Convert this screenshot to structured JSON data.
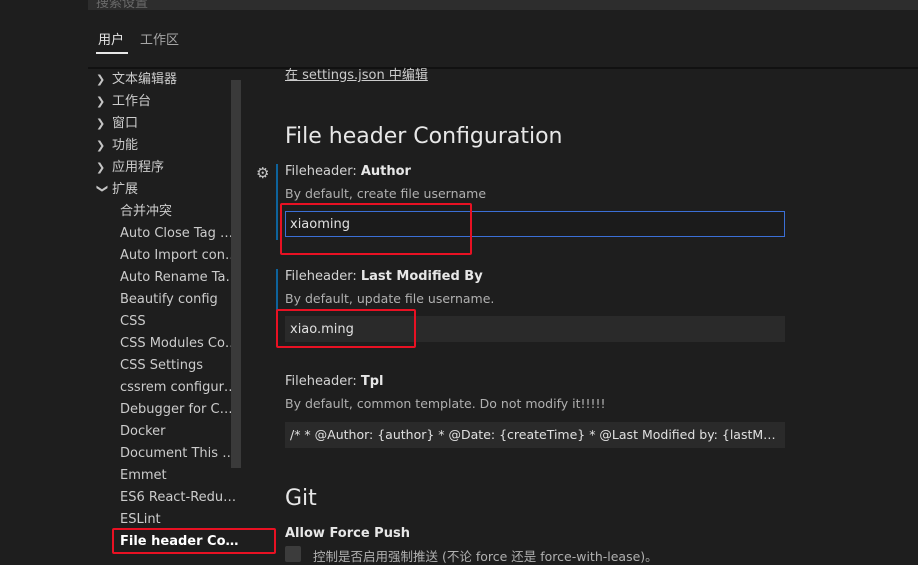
{
  "search": {
    "placeholder": "搜索设置"
  },
  "tabs": [
    {
      "label": "用户"
    },
    {
      "label": "工作区"
    }
  ],
  "toc": {
    "top_items": [
      {
        "label": "文本编辑器",
        "state": "collapsed"
      },
      {
        "label": "工作台",
        "state": "collapsed"
      },
      {
        "label": "窗口",
        "state": "collapsed"
      },
      {
        "label": "功能",
        "state": "collapsed"
      },
      {
        "label": "应用程序",
        "state": "collapsed"
      },
      {
        "label": "扩展",
        "state": "expanded"
      }
    ],
    "children": [
      {
        "label": "合并冲突"
      },
      {
        "label": "Auto Close Tag con..."
      },
      {
        "label": "Auto Import config..."
      },
      {
        "label": "Auto Rename Tag c..."
      },
      {
        "label": "Beautify config"
      },
      {
        "label": "CSS"
      },
      {
        "label": "CSS Modules Confi..."
      },
      {
        "label": "CSS Settings"
      },
      {
        "label": "cssrem configuration"
      },
      {
        "label": "Debugger for Chro..."
      },
      {
        "label": "Docker"
      },
      {
        "label": "Document This con..."
      },
      {
        "label": "Emmet"
      },
      {
        "label": "ES6 React-Redux S..."
      },
      {
        "label": "ESLint"
      },
      {
        "label": "File header Confi..."
      }
    ],
    "selected": "File header Confi..."
  },
  "content": {
    "edit_link": "在 settings.json 中编辑",
    "section_title": "File header Configuration",
    "settings": {
      "author": {
        "prefix": "Fileheader: ",
        "name": "Author",
        "description": "By default, create file username",
        "value": "xiaoming"
      },
      "last_modified": {
        "prefix": "Fileheader: ",
        "name": "Last Modified By",
        "description": "By default, update file username.",
        "value": "xiao.ming"
      },
      "tpl": {
        "prefix": "Fileheader: ",
        "name": "Tpl",
        "description": "By default, common template. Do not modify it!!!!!",
        "value": "/* * @Author: {author}  * @Date: {createTime}  * @Last Modified by:   {lastModifiedBy}  * @Last Modified time: {updateTime}  */"
      }
    },
    "git": {
      "section_title": "Git",
      "force_push_label": "Allow Force Push",
      "force_push_description": "控制是否启用强制推送 (不论 force 还是 force-with-lease)。",
      "force_push_checked": false
    }
  },
  "colors": {
    "background": "#1e1e1e",
    "accent_focus": "#3b6fd6",
    "modified_bar": "#0e639c",
    "highlight_box": "#e81123"
  }
}
